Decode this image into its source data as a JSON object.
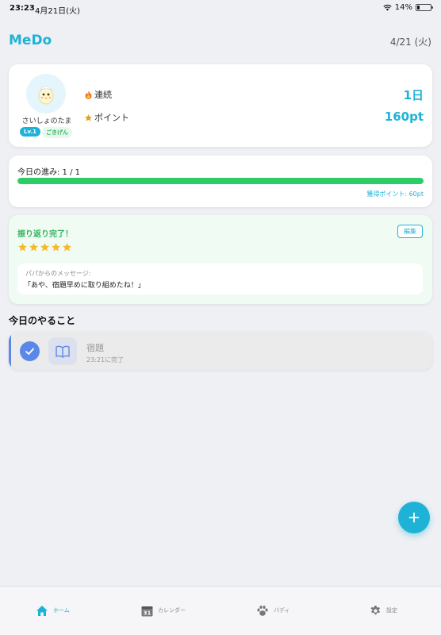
{
  "status_bar": {
    "time": "23:23",
    "date": "4月21日(火)",
    "battery": "14%"
  },
  "header": {
    "app_title": "MeDo",
    "date": "4/21 (火)"
  },
  "profile": {
    "buddy_name": "さいしょのたまご",
    "level": "Lv.1",
    "mood": "ごきげん",
    "streak_label": "連続",
    "streak_value": "1日",
    "points_label": "ポイント",
    "points_value": "160pt"
  },
  "progress": {
    "label": "今日の進み: 1 / 1",
    "fraction": 1.0,
    "earned_points": "獲得ポイント: 60pt"
  },
  "review": {
    "title": "振り返り完了！",
    "edit_label": "編集",
    "stars": 5,
    "message_from": "パパからのメッセージ:",
    "message_text": "「あや、宿題早めに取り組めたね！」"
  },
  "todo": {
    "section_title": "今日のやること",
    "tasks": [
      {
        "name": "宿題",
        "status": "23:21に完了",
        "done": true,
        "icon": "book-icon"
      }
    ]
  },
  "fab": {
    "icon": "plus-icon"
  },
  "tab_bar": {
    "tabs": [
      {
        "label": "ホーム",
        "icon": "home-icon",
        "active": true
      },
      {
        "label": "カレンダー",
        "icon": "calendar-icon",
        "active": false
      },
      {
        "label": "バディ",
        "icon": "paw-icon",
        "active": false
      },
      {
        "label": "設定",
        "icon": "gear-icon",
        "active": false
      }
    ],
    "calendar_day": "31"
  },
  "colors": {
    "accent": "#1eb3d6",
    "success": "#2ecc66",
    "task_accent": "#5b88e8",
    "star": "#f5b92a"
  }
}
